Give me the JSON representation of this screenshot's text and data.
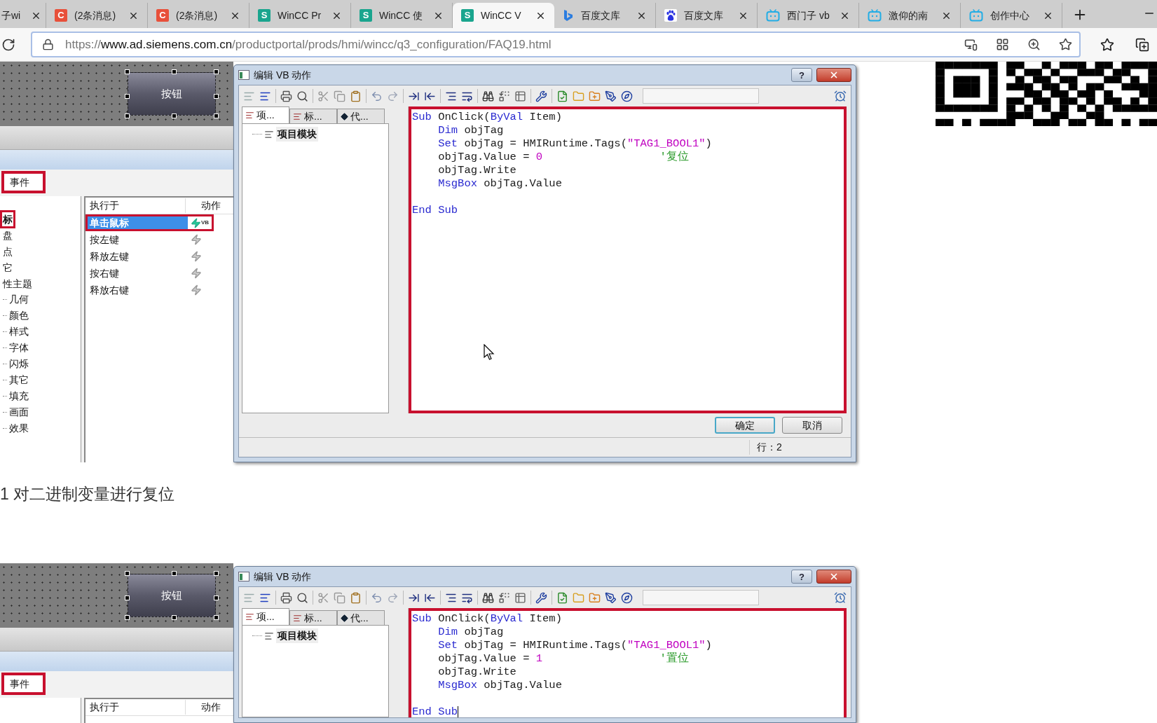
{
  "browser": {
    "tabs": [
      {
        "title": "子wi",
        "kind": "none",
        "selected": false
      },
      {
        "title": "(2条消息)",
        "kind": "letter",
        "icon_text": "C",
        "color": "#e8503a",
        "selected": false
      },
      {
        "title": "(2条消息)",
        "kind": "letter",
        "icon_text": "C",
        "color": "#e8503a",
        "selected": false
      },
      {
        "title": "WinCC Pr",
        "kind": "letter",
        "icon_text": "S",
        "color": "#1aa58e",
        "selected": false
      },
      {
        "title": "WinCC 使",
        "kind": "letter",
        "icon_text": "S",
        "color": "#1aa58e",
        "selected": false
      },
      {
        "title": "WinCC V",
        "kind": "letter",
        "icon_text": "S",
        "color": "#1aa58e",
        "selected": true
      },
      {
        "title": "百度文库",
        "kind": "ribbon",
        "selected": false
      },
      {
        "title": "百度文库",
        "kind": "paw",
        "selected": false
      },
      {
        "title": "西门子 vb",
        "kind": "tv",
        "selected": false
      },
      {
        "title": "激仰的南",
        "kind": "tv",
        "selected": false
      },
      {
        "title": "创作中心",
        "kind": "tv",
        "selected": false
      }
    ],
    "url": {
      "scheme": "https://",
      "host": "www.ad.siemens.com.cn",
      "path": "/productportal/prods/hmi/wincc/q3_configuration/FAQ19.html"
    }
  },
  "qr_code": true,
  "content": [
    {
      "kind": "figure",
      "canvas_button": "按钮",
      "events_tab": "事件",
      "tree": [
        {
          "label": "标",
          "selected": true
        },
        {
          "label": "盘",
          "selected": false
        },
        {
          "label": "点",
          "selected": false
        },
        {
          "label": "它",
          "selected": false
        },
        {
          "label": "性主题",
          "selected": false,
          "children": [
            {
              "label": "几何",
              "selected": false
            },
            {
              "label": "颜色",
              "selected": false
            },
            {
              "label": "样式",
              "selected": false
            },
            {
              "label": "字体",
              "selected": false
            },
            {
              "label": "闪烁",
              "selected": false
            },
            {
              "label": "其它",
              "selected": false
            },
            {
              "label": "填充",
              "selected": false
            },
            {
              "label": "画面",
              "selected": false
            },
            {
              "label": "效果",
              "selected": false
            }
          ]
        }
      ],
      "event_columns": [
        "执行于",
        "动作"
      ],
      "events": [
        {
          "name": "单击鼠标",
          "selected": true,
          "kind": "script",
          "action_label": "VB"
        },
        {
          "name": "按左键",
          "selected": false,
          "kind": "empty"
        },
        {
          "name": "释放左键",
          "selected": false,
          "kind": "empty"
        },
        {
          "name": "按右键",
          "selected": false,
          "kind": "empty"
        },
        {
          "name": "释放右键",
          "selected": false,
          "kind": "empty"
        }
      ],
      "dialog": {
        "title": "编辑 VB 动作",
        "help_button": "?",
        "mouse_pointer": true,
        "side_tabs": [
          {
            "label": "项...",
            "selected": true
          },
          {
            "label": "标...",
            "selected": false
          },
          {
            "label": "代...",
            "selected": false
          }
        ],
        "module": "项目模块",
        "code": [
          {
            "kind": "code",
            "caret": false,
            "tokens": [
              {
                "kind": "kw",
                "t": "Sub"
              },
              {
                "kind": "txt",
                "t": " OnClick("
              },
              {
                "kind": "kw",
                "t": "ByVal"
              },
              {
                "kind": "txt",
                "t": " Item)"
              }
            ]
          },
          {
            "kind": "code",
            "caret": false,
            "tokens": [
              {
                "kind": "kw",
                "t": "    Dim"
              },
              {
                "kind": "txt",
                "t": " objTag"
              }
            ]
          },
          {
            "kind": "code",
            "caret": false,
            "tokens": [
              {
                "kind": "kw",
                "t": "    Set"
              },
              {
                "kind": "txt",
                "t": " objTag = HMIRuntime.Tags("
              },
              {
                "kind": "str",
                "t": "\"TAG1_BOOL1\""
              },
              {
                "kind": "txt",
                "t": ")"
              }
            ]
          },
          {
            "kind": "code",
            "caret": false,
            "tokens": [
              {
                "kind": "txt",
                "t": "    objTag.Value = "
              },
              {
                "kind": "num",
                "t": "0"
              },
              {
                "kind": "cmt",
                "t": "                  '复位"
              }
            ]
          },
          {
            "kind": "code",
            "caret": false,
            "tokens": [
              {
                "kind": "txt",
                "t": "    objTag.Write"
              }
            ]
          },
          {
            "kind": "code",
            "caret": false,
            "tokens": [
              {
                "kind": "kw",
                "t": "    MsgBox"
              },
              {
                "kind": "txt",
                "t": " objTag.Value"
              }
            ]
          },
          {
            "kind": "blank"
          },
          {
            "kind": "code",
            "caret": false,
            "tokens": [
              {
                "kind": "kw",
                "t": "End Sub"
              }
            ]
          }
        ],
        "buttons": [
          {
            "label": "确定",
            "default": true
          },
          {
            "label": "取消",
            "default": false
          }
        ],
        "status": "行：2"
      }
    },
    {
      "kind": "caption",
      "text": "1 对二进制变量进行复位"
    },
    {
      "kind": "figure",
      "canvas_button": "按钮",
      "events_tab": "事件",
      "event_columns": [
        "执行于",
        "动作"
      ],
      "dialog": {
        "title": "编辑 VB 动作",
        "help_button": "?",
        "mouse_pointer": false,
        "side_tabs": [
          {
            "label": "项...",
            "selected": true
          },
          {
            "label": "标...",
            "selected": false
          },
          {
            "label": "代...",
            "selected": false
          }
        ],
        "module": "项目模块",
        "code": [
          {
            "kind": "code",
            "caret": false,
            "tokens": [
              {
                "kind": "kw",
                "t": "Sub"
              },
              {
                "kind": "txt",
                "t": " OnClick("
              },
              {
                "kind": "kw",
                "t": "ByVal"
              },
              {
                "kind": "txt",
                "t": " Item)"
              }
            ]
          },
          {
            "kind": "code",
            "caret": false,
            "tokens": [
              {
                "kind": "kw",
                "t": "    Dim"
              },
              {
                "kind": "txt",
                "t": " objTag"
              }
            ]
          },
          {
            "kind": "code",
            "caret": false,
            "tokens": [
              {
                "kind": "kw",
                "t": "    Set"
              },
              {
                "kind": "txt",
                "t": " objTag = HMIRuntime.Tags("
              },
              {
                "kind": "str",
                "t": "\"TAG1_BOOL1\""
              },
              {
                "kind": "txt",
                "t": ")"
              }
            ]
          },
          {
            "kind": "code",
            "caret": false,
            "tokens": [
              {
                "kind": "txt",
                "t": "    objTag.Value = "
              },
              {
                "kind": "num",
                "t": "1"
              },
              {
                "kind": "cmt",
                "t": "                  '置位"
              }
            ]
          },
          {
            "kind": "code",
            "caret": false,
            "tokens": [
              {
                "kind": "txt",
                "t": "    objTag.Write"
              }
            ]
          },
          {
            "kind": "code",
            "caret": false,
            "tokens": [
              {
                "kind": "kw",
                "t": "    MsgBox"
              },
              {
                "kind": "txt",
                "t": " objTag.Value"
              }
            ]
          },
          {
            "kind": "blank"
          },
          {
            "kind": "code",
            "caret": true,
            "tokens": [
              {
                "kind": "kw",
                "t": "End Sub"
              }
            ]
          }
        ]
      }
    }
  ]
}
